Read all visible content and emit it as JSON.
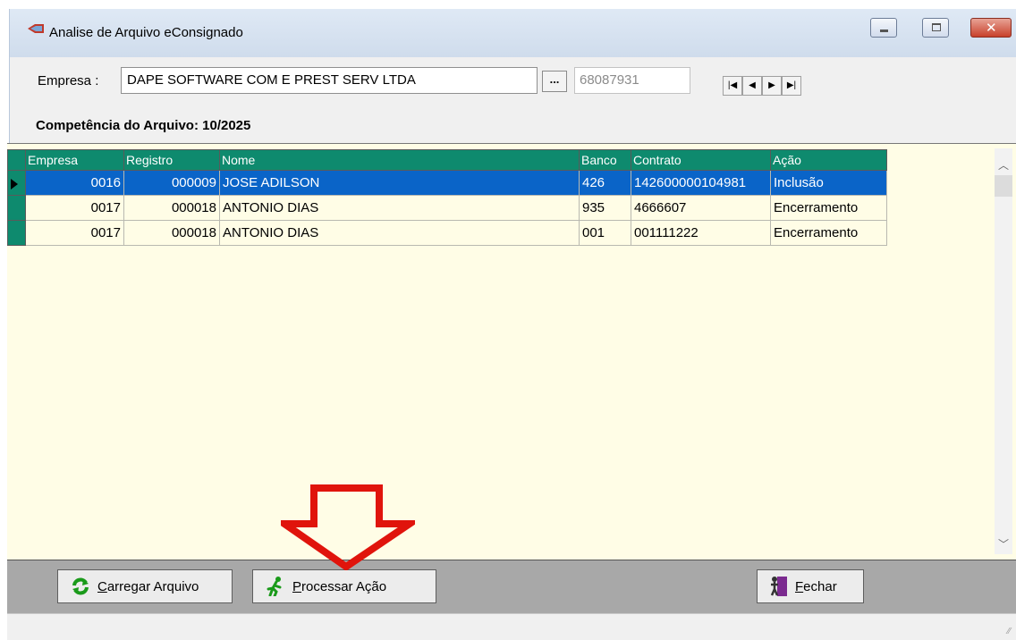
{
  "window": {
    "title": "Analise de Arquivo eConsignado",
    "accent": "#0e8a6e",
    "selection_color": "#0a64c8",
    "grid_background": "#fffde6"
  },
  "filter": {
    "empresa_label": "Empresa :",
    "empresa_value": "DAPE SOFTWARE COM E PREST SERV LTDA",
    "lookup_label": "...",
    "code_value": "68087931",
    "nav": [
      "first-icon",
      "prev-icon",
      "next-icon",
      "last-icon"
    ]
  },
  "competencia": {
    "label": "Competência do Arquivo:",
    "value": "10/2025"
  },
  "grid": {
    "columns": [
      "Empresa",
      "Registro",
      "Nome",
      "Banco",
      "Contrato",
      "Ação"
    ],
    "rows": [
      {
        "empresa": "0016",
        "registro": "000009",
        "nome": "JOSE ADILSON",
        "banco": "426",
        "contrato": "142600000104981",
        "acao": "Inclusão",
        "selected": true
      },
      {
        "empresa": "0017",
        "registro": "000018",
        "nome": "ANTONIO DIAS",
        "banco": "935",
        "contrato": "4666607",
        "acao": "Encerramento",
        "selected": false
      },
      {
        "empresa": "0017",
        "registro": "000018",
        "nome": "ANTONIO DIAS",
        "banco": "001",
        "contrato": "001111222",
        "acao": "Encerramento",
        "selected": false
      }
    ]
  },
  "buttons": {
    "carregar_prefix": "C",
    "carregar_rest": "arregar Arquivo",
    "processar_prefix": "P",
    "processar_rest": "rocessar Ação",
    "fechar_prefix": "F",
    "fechar_rest": "echar"
  }
}
